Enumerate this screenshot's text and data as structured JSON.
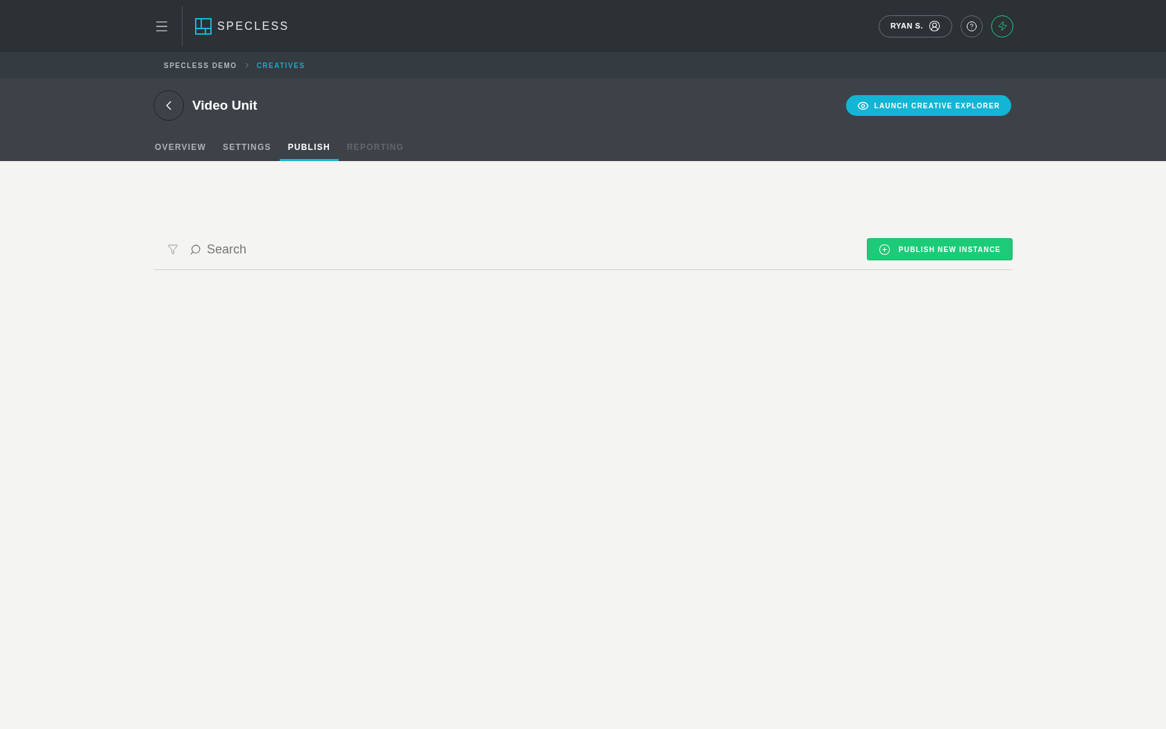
{
  "brand": "SPECLESS",
  "user": {
    "name": "RYAN S."
  },
  "breadcrumb": [
    {
      "label": "SPECLESS DEMO",
      "current": false
    },
    {
      "label": "CREATIVES",
      "current": true
    }
  ],
  "page": {
    "title": "Video Unit",
    "action": "LAUNCH CREATIVE EXPLORER"
  },
  "tabs": [
    {
      "label": "OVERVIEW",
      "selected": false,
      "disabled": false
    },
    {
      "label": "SETTINGS",
      "selected": false,
      "disabled": false
    },
    {
      "label": "PUBLISH",
      "selected": true,
      "disabled": false
    },
    {
      "label": "REPORTING",
      "selected": false,
      "disabled": true
    }
  ],
  "search": {
    "placeholder": "Search"
  },
  "publish_button": "PUBLISH NEW INSTANCE"
}
